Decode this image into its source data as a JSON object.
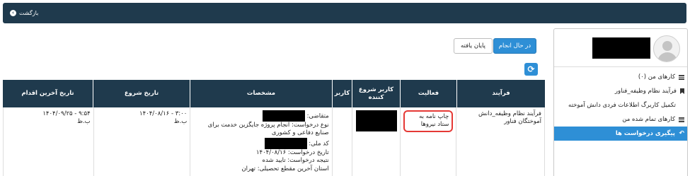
{
  "header": {
    "back_label": "بازگشت"
  },
  "sidebar": {
    "items": [
      {
        "label": "کارهای من (۰)",
        "icon": "list-icon"
      },
      {
        "label": "فرآیند نظام وظیفه_فناور",
        "icon": "bookmark-icon"
      },
      {
        "label": "تکمیل کاربرگ اطلاعات فردی دانش آموخته",
        "icon": ""
      },
      {
        "label": "کارهای تمام شده من",
        "icon": "list-icon"
      },
      {
        "label": "پیگیری درخواست ها",
        "icon": "reply-icon"
      }
    ]
  },
  "filters": {
    "in_progress_label": "در حال انجام",
    "finished_label": "پایان یافته"
  },
  "table": {
    "headers": {
      "process": "فرآیند",
      "activity": "فعالیت",
      "starter": "کاربر شروع کننده",
      "user": "کاربر",
      "details": "مشخصات",
      "start_date": "تاریخ شروع",
      "last_action_date": "تاریخ آخرین اقدام"
    },
    "row": {
      "process": "فرآیند نظام وظیفه_دانش آموختگان فناور",
      "activity": "چاپ نامه به ستاد نیروها",
      "details": {
        "applicant_label": "متقاضی:",
        "request_type": "نوع درخواست: انجام پروژه جایگزین خدمت برای صنایع دفاعی و کشوری",
        "national_code_label": "کد ملی:",
        "request_date": "تاریخ درخواست: ۱۴۰۴/۰۸/۱۶",
        "request_result": "نتیجه درخواست: تایید شده",
        "province": "استان آخرین مقطع تحصیلی: تهران"
      },
      "start_date": "۱۴۰۴/۰۸/۱۶ - ۳:۰۰",
      "start_period": "ب.ظ",
      "last_action_date": "۱۴۰۴/۰۹/۲۵ - ۹:۵۴",
      "last_action_period": "ب.ظ"
    }
  }
}
